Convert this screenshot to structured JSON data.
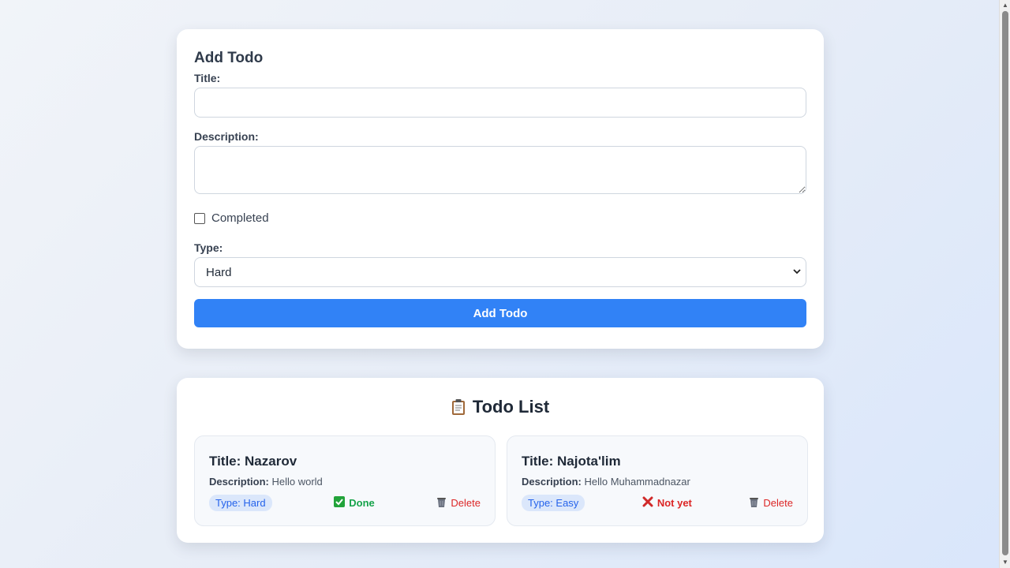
{
  "form": {
    "heading": "Add Todo",
    "title_label": "Title:",
    "title_value": "",
    "description_label": "Description:",
    "description_value": "",
    "completed_label": "Completed",
    "completed_checked": false,
    "type_label": "Type:",
    "type_selected": "Hard",
    "submit_label": "Add Todo"
  },
  "list": {
    "heading": "Todo List",
    "heading_icon": "clipboard-icon",
    "items": [
      {
        "title": "Title: Nazarov",
        "description_label": "Description:",
        "description": "Hello world",
        "type": "Type: Hard",
        "status": "Done",
        "status_icon": "check-icon",
        "delete_label": "Delete"
      },
      {
        "title": "Title: Najota'lim",
        "description_label": "Description:",
        "description": "Hello Muhammadnazar",
        "type": "Type: Easy",
        "status": "Not yet",
        "status_icon": "cross-icon",
        "delete_label": "Delete"
      }
    ]
  },
  "colors": {
    "primary": "#3182f6",
    "done": "#16a34a",
    "not_yet": "#dc2626",
    "badge_bg": "#dbe7fb"
  }
}
